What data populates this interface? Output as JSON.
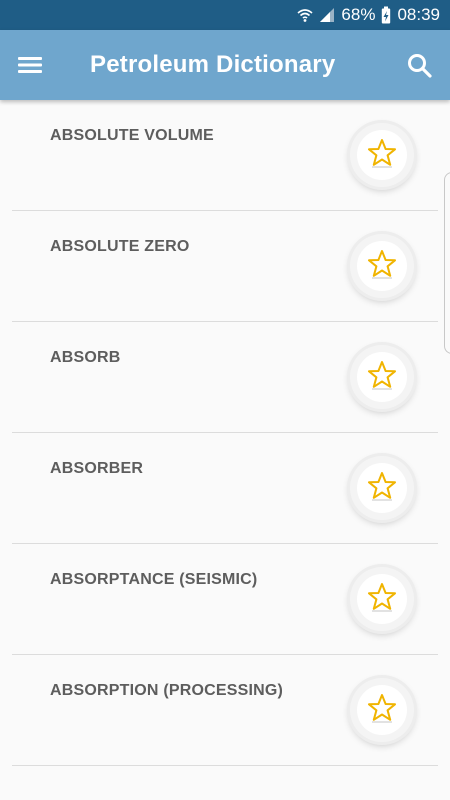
{
  "status_bar": {
    "battery": "68%",
    "time": "08:39"
  },
  "app_bar": {
    "title": "Petroleum Dictionary"
  },
  "terms": [
    "ABSOLUTE VOLUME",
    "ABSOLUTE ZERO",
    "ABSORB",
    "ABSORBER",
    "ABSORPTANCE (SEISMIC)",
    "ABSORPTION (PROCESSING)"
  ],
  "icons": {
    "menu": "hamburger-menu-icon",
    "search": "search-icon",
    "favorite": "star-outline-icon",
    "wifi": "wifi-icon",
    "signal": "signal-icon",
    "battery": "battery-charging-icon"
  },
  "colors": {
    "status_bar": "#1f5d86",
    "app_bar": "#6fa6cd",
    "star": "#f0b400",
    "term_text": "#5d5d5d"
  }
}
